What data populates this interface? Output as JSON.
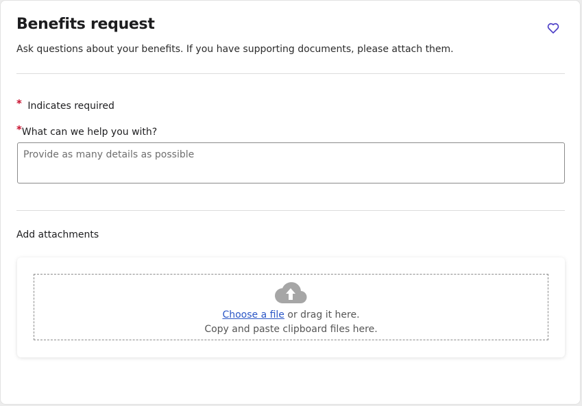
{
  "header": {
    "title": "Benefits request",
    "subtitle": "Ask questions about your benefits. If you have supporting documents, please attach them."
  },
  "form": {
    "required_marker": "*",
    "required_note": "Indicates required",
    "question_label": "What can we help you with?",
    "question_placeholder": "Provide as many details as possible",
    "question_value": ""
  },
  "attachments": {
    "label": "Add attachments",
    "choose_link": "Choose a file",
    "drag_text": "or drag it here.",
    "clipboard_text": "Copy and paste clipboard files here."
  },
  "icons": {
    "favorite": "heart-icon",
    "upload": "cloud-upload-icon"
  },
  "colors": {
    "required": "#c8102e",
    "link": "#2a56c6",
    "favorite": "#4a3cc6"
  }
}
